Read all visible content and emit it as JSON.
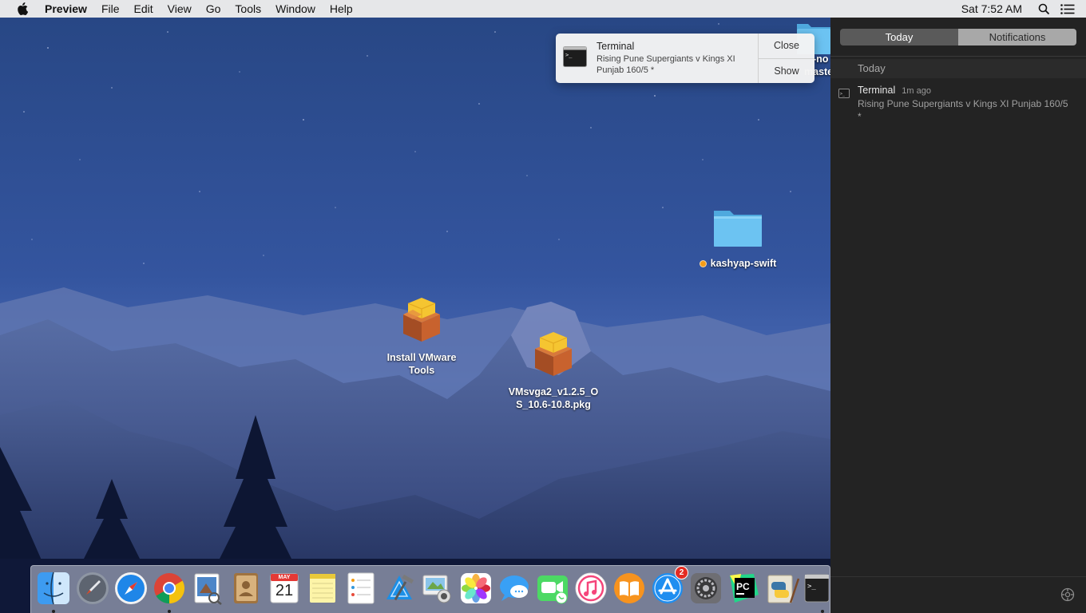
{
  "menubar": {
    "app_name": "Preview",
    "menus": [
      "File",
      "Edit",
      "View",
      "Go",
      "Tools",
      "Window",
      "Help"
    ],
    "clock": "Sat 7:52 AM",
    "icons": [
      "apple-icon",
      "spotlight-search-icon",
      "notification-center-list-icon"
    ]
  },
  "desktop": {
    "icons": [
      {
        "name": "Install VMware Tools",
        "line1": "Install VMware",
        "line2": "Tools",
        "icon": "package-icon"
      },
      {
        "name": "VMsvga2_v1.2.5_OS_10.6-10.8.pkg",
        "line1": "VMsvga2_v1.2.5_O",
        "line2": "S_10.6-10.8.pkg",
        "icon": "package-icon"
      },
      {
        "name": "kashyap-swift",
        "icon": "folder-icon",
        "tag_color": "#f49c18"
      },
      {
        "name": "-no master (partially hidden)",
        "line1": "-no",
        "line2": "maste",
        "icon": "folder-icon"
      }
    ]
  },
  "banner": {
    "app": "Terminal",
    "message": "Rising Pune Supergiants v Kings XI Punjab 160/5 *",
    "close_label": "Close",
    "show_label": "Show"
  },
  "notification_center": {
    "tabs": {
      "today": "Today",
      "notifications": "Notifications",
      "active": "Today"
    },
    "section": "Today",
    "items": [
      {
        "app": "Terminal",
        "time": "1m ago",
        "text": "Rising Pune Supergiants v Kings XI Punjab 160/5 *"
      }
    ]
  },
  "dock": {
    "apps": [
      "Finder",
      "Launchpad",
      "Safari",
      "Google Chrome",
      "Preview",
      "Contacts",
      "Calendar",
      "Notes",
      "Reminders",
      "Xcode",
      "Image Capture",
      "Photos",
      "Messages",
      "FaceTime",
      "iTunes",
      "iBooks",
      "App Store",
      "System Preferences",
      "PyCharm",
      "Python Launcher",
      "Terminal"
    ],
    "calendar": {
      "month": "MAY",
      "day": "21"
    },
    "app_store_badge": "2",
    "running": [
      "Finder",
      "Google Chrome",
      "Terminal"
    ]
  },
  "colors": {
    "sky_top": "#2c4b8c",
    "sky_bottom": "#3d5ca8",
    "nc_background": "#232323",
    "folder_blue": "#5bb7ec",
    "tag_orange": "#f49c18",
    "badge_red": "#e52b22"
  }
}
